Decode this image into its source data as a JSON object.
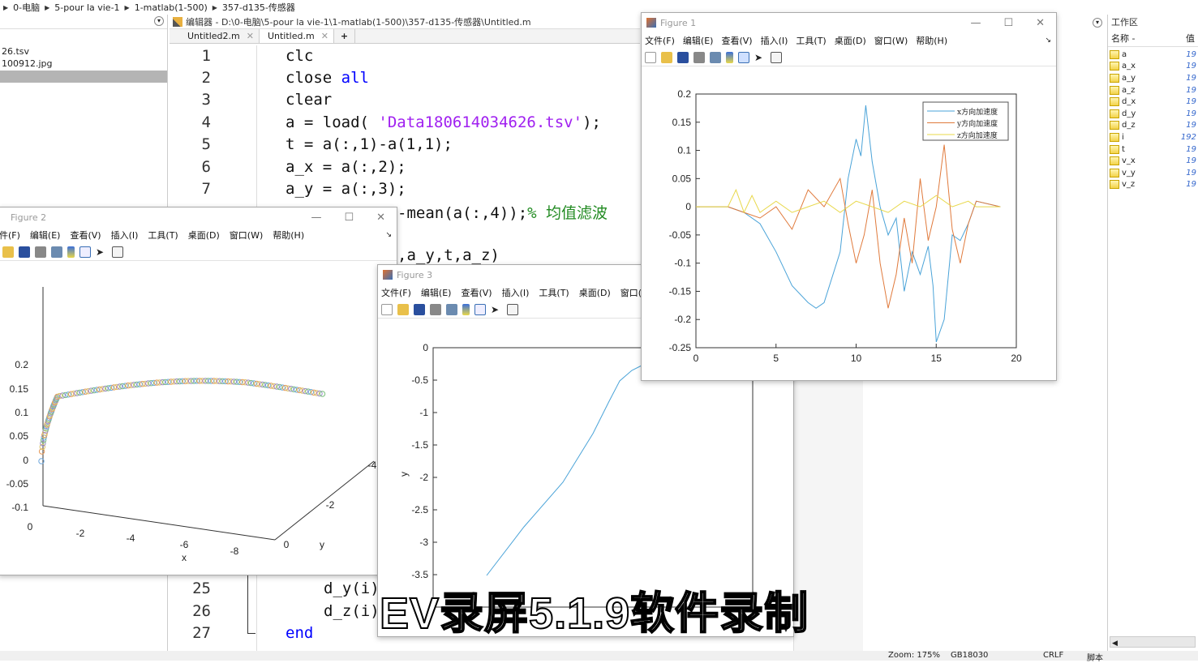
{
  "breadcrumb": [
    "0-电脑",
    "5-pour la vie-1",
    "1-matlab(1-500)",
    "357-d135-传感器"
  ],
  "files": {
    "file1": "26.tsv",
    "file2": "100912.jpg"
  },
  "editor": {
    "title": "编辑器 - D:\\0-电脑\\5-pour la vie-1\\1-matlab(1-500)\\357-d135-传感器\\Untitled.m",
    "tabs": [
      {
        "label": "Untitled2.m"
      },
      {
        "label": "Untitled.m"
      }
    ],
    "add_tab": "+",
    "close_glyph": "✕",
    "lines_top": [
      {
        "n": "1",
        "code": "clc"
      },
      {
        "n": "2",
        "code": "close ",
        "kw": "all"
      },
      {
        "n": "3",
        "code": "clear"
      },
      {
        "n": "4",
        "code": "a = load( ",
        "str": "'Data180614034626.tsv'",
        "rest": ");"
      },
      {
        "n": "5",
        "code": "t = a(:,1)-a(1,1);"
      },
      {
        "n": "6",
        "code": "a_x = a(:,2);"
      },
      {
        "n": "7",
        "code": "a_y = a(:,3);"
      }
    ],
    "partial_8": "-mean(a(:,4));",
    "partial_8_comment": "% 均值滤波",
    "partial_9": ",a_y,t,a_z)",
    "lines_bottom": [
      {
        "n": "25",
        "code": "d_y(i)"
      },
      {
        "n": "26",
        "code": "d_z(i)"
      },
      {
        "n": "27",
        "kw": "end"
      }
    ]
  },
  "workspace": {
    "title": "工作区",
    "col_name": "名称 -",
    "col_value": "值",
    "vars": [
      {
        "name": "a",
        "val": "19"
      },
      {
        "name": "a_x",
        "val": "19"
      },
      {
        "name": "a_y",
        "val": "19"
      },
      {
        "name": "a_z",
        "val": "19"
      },
      {
        "name": "d_x",
        "val": "19"
      },
      {
        "name": "d_y",
        "val": "19"
      },
      {
        "name": "d_z",
        "val": "19"
      },
      {
        "name": "i",
        "val": "192"
      },
      {
        "name": "t",
        "val": "19"
      },
      {
        "name": "v_x",
        "val": "19"
      },
      {
        "name": "v_y",
        "val": "19"
      },
      {
        "name": "v_z",
        "val": "19"
      }
    ]
  },
  "status": {
    "zoom": "Zoom: 175%",
    "encoding": "GB18030",
    "eol": "CRLF",
    "mode": "脚本"
  },
  "menus": {
    "file": "文件(F)",
    "edit": "编辑(E)",
    "view": "查看(V)",
    "insert": "插入(I)",
    "tools": "工具(T)",
    "desktop": "桌面(D)",
    "window": "窗口(W)",
    "help": "帮助(H)",
    "file_cut": "件(F)"
  },
  "figure1": {
    "title": "Figure 1",
    "chart_data": {
      "type": "line",
      "xlim": [
        0,
        20
      ],
      "ylim": [
        -0.25,
        0.2
      ],
      "xticks": [
        "0",
        "5",
        "10",
        "15",
        "20"
      ],
      "yticks": [
        "0.2",
        "0.15",
        "0.1",
        "0.05",
        "0",
        "-0.05",
        "-0.1",
        "-0.15",
        "-0.2",
        "-0.25"
      ],
      "legend_position": "top-right",
      "series": [
        {
          "name": "x方向加速度",
          "color": "#4aa3d8",
          "x": [
            0,
            2,
            3,
            4,
            5,
            6,
            7,
            7.5,
            8,
            9,
            9.5,
            10,
            10.3,
            10.6,
            11,
            11.5,
            12,
            12.5,
            13,
            13.5,
            14,
            14.5,
            14.8,
            15,
            15.5,
            16,
            16.5,
            17,
            17.5,
            19
          ],
          "y": [
            0,
            0,
            -0.01,
            -0.03,
            -0.08,
            -0.14,
            -0.17,
            -0.18,
            -0.17,
            -0.08,
            0.05,
            0.12,
            0.09,
            0.18,
            0.08,
            0.0,
            -0.05,
            -0.02,
            -0.15,
            -0.08,
            -0.12,
            -0.07,
            -0.14,
            -0.24,
            -0.2,
            -0.05,
            -0.06,
            -0.03,
            0.01,
            0.0
          ]
        },
        {
          "name": "y方向加速度",
          "color": "#e07a3c",
          "x": [
            0,
            2,
            3,
            4,
            5,
            6,
            7,
            8,
            9,
            9.5,
            10,
            10.5,
            11,
            11.5,
            12,
            12.5,
            13,
            13.5,
            14,
            14.5,
            15,
            15.5,
            16,
            16.5,
            17,
            17.5,
            19
          ],
          "y": [
            0,
            0,
            -0.01,
            -0.02,
            0.0,
            -0.04,
            0.03,
            0.0,
            0.05,
            -0.03,
            -0.1,
            -0.05,
            0.03,
            -0.1,
            -0.18,
            -0.12,
            -0.02,
            -0.1,
            0.05,
            -0.06,
            0.0,
            0.11,
            -0.04,
            -0.1,
            -0.03,
            0.01,
            0.0
          ]
        },
        {
          "name": "z方向加速度",
          "color": "#e8d84a",
          "x": [
            0,
            2,
            2.5,
            3,
            3.5,
            4,
            5,
            6,
            7,
            8,
            9,
            10,
            11,
            12,
            13,
            14,
            15,
            16,
            17,
            17.5,
            19
          ],
          "y": [
            0,
            0,
            0.03,
            -0.01,
            0.02,
            -0.01,
            0.01,
            -0.01,
            0.0,
            0.01,
            -0.01,
            0.01,
            0.0,
            -0.01,
            0.01,
            0.0,
            0.02,
            0.0,
            0.01,
            0.0,
            0.0
          ]
        }
      ]
    }
  },
  "figure2": {
    "title": "Figure 2",
    "chart_data": {
      "type": "scatter",
      "zticks": [
        "0.2",
        "0.15",
        "0.1",
        "0.05",
        "0",
        "-0.05",
        "-0.1"
      ],
      "xticks": [
        "0",
        "-2",
        "-4",
        "-6",
        "-8"
      ],
      "yticks": [
        "0",
        "-2",
        "-4"
      ],
      "xlabel": "x",
      "ylabel": "y"
    }
  },
  "figure3": {
    "title": "Figure 3",
    "chart_data": {
      "type": "line",
      "ylabel": "y",
      "yticks": [
        "0",
        "-0.5",
        "-1",
        "-1.5",
        "-2",
        "-2.5",
        "-3",
        "-3.5"
      ],
      "color": "#4aa3d8"
    }
  },
  "watermark": "EV录屏5.1.9软件录制"
}
